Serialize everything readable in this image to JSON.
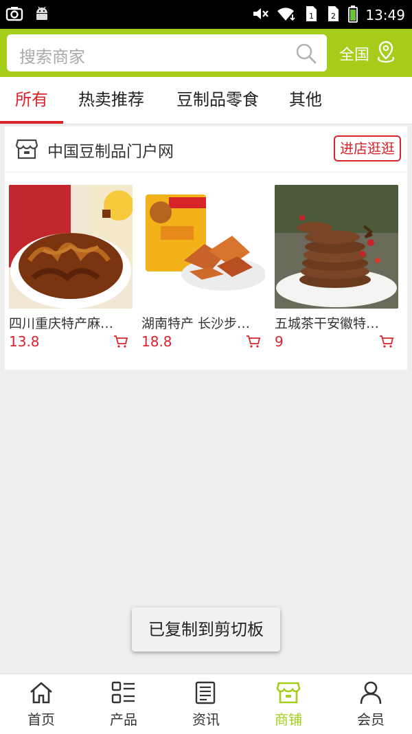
{
  "status_bar": {
    "time": "13:49",
    "left_icons": [
      "screenshot-icon",
      "android-icon"
    ],
    "right_icons": [
      "mute-icon",
      "wifi-icon",
      "sim1-icon",
      "sim2-icon",
      "battery-icon"
    ]
  },
  "header": {
    "search_placeholder": "搜索商家",
    "region_label": "全国",
    "accent_color": "#a6cd1a"
  },
  "tabs": [
    {
      "label": "所有",
      "active": true
    },
    {
      "label": "热卖推荐",
      "active": false
    },
    {
      "label": "豆制品零食",
      "active": false
    },
    {
      "label": "其他",
      "active": false
    }
  ],
  "shop": {
    "name": "中国豆制品门户网",
    "enter_label": "进店逛逛",
    "products": [
      {
        "name": "四川重庆特产麻…",
        "price": "13.8"
      },
      {
        "name": "湖南特产 长沙步…",
        "price": "18.8"
      },
      {
        "name": "五城茶干安徽特…",
        "price": "9"
      }
    ]
  },
  "toast": {
    "text": "已复制到剪切板"
  },
  "bottom_nav": [
    {
      "label": "首页",
      "icon": "home-icon",
      "active": false
    },
    {
      "label": "产品",
      "icon": "grid-list-icon",
      "active": false
    },
    {
      "label": "资讯",
      "icon": "news-icon",
      "active": false
    },
    {
      "label": "商铺",
      "icon": "shop-icon",
      "active": true
    },
    {
      "label": "会员",
      "icon": "user-icon",
      "active": false
    }
  ],
  "colors": {
    "brand": "#a6cd1a",
    "accent_red": "#d8232a"
  }
}
